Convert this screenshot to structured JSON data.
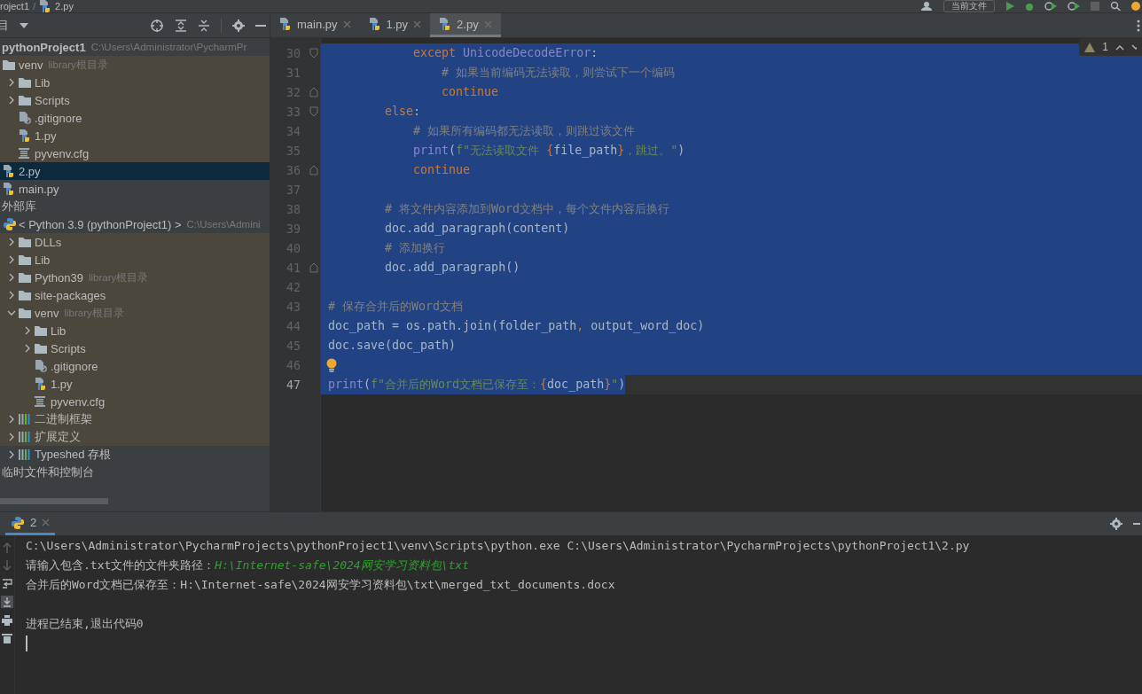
{
  "title_bar": {
    "breadcrumbs": [
      "roject1",
      "2.py"
    ],
    "separator": "/",
    "run_config": "当前文件"
  },
  "project_panel": {
    "title": "目",
    "tree": [
      {
        "kind": "project",
        "label": "pythonProject1",
        "hint": "C:\\Users\\Administrator\\PycharmPr",
        "library": false,
        "selected": false,
        "children": [
          {
            "kind": "folder",
            "label": "venv",
            "hint": "library根目录",
            "library": true,
            "selected": false,
            "children": [
              {
                "kind": "folder",
                "label": "Lib",
                "expanded": false,
                "library": true,
                "selected": false
              },
              {
                "kind": "folder",
                "label": "Scripts",
                "expanded": false,
                "library": true,
                "selected": false
              },
              {
                "kind": "ignore",
                "label": ".gitignore",
                "library": true,
                "selected": false
              },
              {
                "kind": "python",
                "label": "1.py",
                "library": true,
                "selected": false
              },
              {
                "kind": "config",
                "label": "pyvenv.cfg",
                "library": true,
                "selected": false
              }
            ]
          },
          {
            "kind": "python",
            "label": "2.py",
            "library": false,
            "selected": true
          },
          {
            "kind": "python",
            "label": "main.py",
            "library": false,
            "selected": false
          }
        ]
      },
      {
        "kind": "group",
        "label": "外部库",
        "library": false,
        "selected": false,
        "children": [
          {
            "kind": "sdk",
            "label": "< Python 3.9 (pythonProject1) >",
            "hint": "C:\\Users\\Admini",
            "library": false,
            "selected": false,
            "children": [
              {
                "kind": "folder",
                "label": "DLLs",
                "expanded": false,
                "library": true,
                "selected": false
              },
              {
                "kind": "folder",
                "label": "Lib",
                "expanded": false,
                "library": true,
                "selected": false
              },
              {
                "kind": "folder",
                "label": "Python39",
                "hint": "library根目录",
                "expanded": false,
                "library": true,
                "selected": false
              },
              {
                "kind": "folder",
                "label": "site-packages",
                "expanded": false,
                "library": true,
                "selected": false
              },
              {
                "kind": "folder",
                "label": "venv",
                "hint": "library根目录",
                "expanded": true,
                "library": true,
                "selected": false,
                "children": [
                  {
                    "kind": "folder",
                    "label": "Lib",
                    "expanded": false,
                    "library": true,
                    "selected": false
                  },
                  {
                    "kind": "folder",
                    "label": "Scripts",
                    "expanded": false,
                    "library": true,
                    "selected": false
                  },
                  {
                    "kind": "ignore",
                    "label": ".gitignore",
                    "library": true,
                    "selected": false
                  },
                  {
                    "kind": "python",
                    "label": "1.py",
                    "library": true,
                    "selected": false
                  },
                  {
                    "kind": "config",
                    "label": "pyvenv.cfg",
                    "library": true,
                    "selected": false
                  }
                ]
              },
              {
                "kind": "library",
                "label": "二进制框架",
                "expanded": false,
                "library": true,
                "selected": false
              },
              {
                "kind": "library",
                "label": "扩展定义",
                "expanded": false,
                "library": true,
                "selected": false
              },
              {
                "kind": "library",
                "label": "Typeshed 存根",
                "expanded": false,
                "library": false,
                "selected": false
              }
            ]
          }
        ]
      },
      {
        "kind": "group",
        "label": "临时文件和控制台",
        "library": false,
        "selected": false
      }
    ]
  },
  "editor": {
    "tabs": [
      {
        "label": "main.py",
        "selected": false
      },
      {
        "label": "1.py",
        "selected": false
      },
      {
        "label": "2.py",
        "selected": true
      }
    ],
    "warnings": "1",
    "lines": [
      {
        "number": "30",
        "selected": true,
        "current": false,
        "bulb": false,
        "fold_start": true,
        "fold_end": false,
        "segments": [
          {
            "kind": "keyword",
            "text": "            except "
          },
          {
            "kind": "builtin",
            "text": "UnicodeDecodeError"
          },
          {
            "kind": "plain",
            "text": ":"
          }
        ]
      },
      {
        "number": "31",
        "selected": true,
        "current": false,
        "bulb": false,
        "fold_start": false,
        "fold_end": false,
        "segments": [
          {
            "kind": "comment",
            "text": "                # 如果当前编码无法读取，则尝试下一个编码"
          }
        ]
      },
      {
        "number": "32",
        "selected": true,
        "current": false,
        "bulb": false,
        "fold_start": false,
        "fold_end": true,
        "segments": [
          {
            "kind": "keyword",
            "text": "                continue"
          }
        ]
      },
      {
        "number": "33",
        "selected": true,
        "current": false,
        "bulb": false,
        "fold_start": true,
        "fold_end": false,
        "segments": [
          {
            "kind": "keyword",
            "text": "        else"
          },
          {
            "kind": "plain",
            "text": ":"
          }
        ]
      },
      {
        "number": "34",
        "selected": true,
        "current": false,
        "bulb": false,
        "fold_start": false,
        "fold_end": false,
        "segments": [
          {
            "kind": "comment",
            "text": "            # 如果所有编码都无法读取，则跳过该文件"
          }
        ]
      },
      {
        "number": "35",
        "selected": true,
        "current": false,
        "bulb": false,
        "fold_start": false,
        "fold_end": false,
        "segments": [
          {
            "kind": "builtin",
            "text": "            print"
          },
          {
            "kind": "plain",
            "text": "("
          },
          {
            "kind": "string",
            "text": "f\"无法读取文件 "
          },
          {
            "kind": "operator",
            "text": "{"
          },
          {
            "kind": "plain",
            "text": "file_path"
          },
          {
            "kind": "operator",
            "text": "}"
          },
          {
            "kind": "string",
            "text": "，跳过。\""
          },
          {
            "kind": "plain",
            "text": ")"
          }
        ]
      },
      {
        "number": "36",
        "selected": true,
        "current": false,
        "bulb": false,
        "fold_start": false,
        "fold_end": true,
        "segments": [
          {
            "kind": "keyword",
            "text": "            continue"
          }
        ]
      },
      {
        "number": "37",
        "selected": true,
        "current": false,
        "bulb": false,
        "fold_start": false,
        "fold_end": false
      },
      {
        "number": "38",
        "selected": true,
        "current": false,
        "bulb": false,
        "fold_start": false,
        "fold_end": false,
        "segments": [
          {
            "kind": "comment",
            "text": "        # 将文件内容添加到Word文档中，每个文件内容后换行"
          }
        ]
      },
      {
        "number": "39",
        "selected": true,
        "current": false,
        "bulb": false,
        "fold_start": false,
        "fold_end": false,
        "segments": [
          {
            "kind": "plain",
            "text": "        doc.add_paragraph(content)"
          }
        ]
      },
      {
        "number": "40",
        "selected": true,
        "current": false,
        "bulb": false,
        "fold_start": false,
        "fold_end": false,
        "segments": [
          {
            "kind": "comment",
            "text": "        # 添加换行"
          }
        ]
      },
      {
        "number": "41",
        "selected": true,
        "current": false,
        "bulb": false,
        "fold_start": false,
        "fold_end": true,
        "segments": [
          {
            "kind": "plain",
            "text": "        doc.add_paragraph()"
          }
        ]
      },
      {
        "number": "42",
        "selected": true,
        "current": false,
        "bulb": false,
        "fold_start": false,
        "fold_end": false
      },
      {
        "number": "43",
        "selected": true,
        "current": false,
        "bulb": false,
        "fold_start": false,
        "fold_end": false,
        "segments": [
          {
            "kind": "comment",
            "text": "# 保存合并后的Word文档"
          }
        ]
      },
      {
        "number": "44",
        "selected": true,
        "current": false,
        "bulb": false,
        "fold_start": false,
        "fold_end": false,
        "segments": [
          {
            "kind": "plain",
            "text": "doc_path = os.path.join(folder_path"
          },
          {
            "kind": "operator",
            "text": ","
          },
          {
            "kind": "plain",
            "text": " output_word_doc)"
          }
        ]
      },
      {
        "number": "45",
        "selected": true,
        "current": false,
        "bulb": false,
        "fold_start": false,
        "fold_end": false,
        "segments": [
          {
            "kind": "plain",
            "text": "doc.save(doc_path)"
          }
        ]
      },
      {
        "number": "46",
        "selected": true,
        "current": false,
        "bulb": true,
        "fold_start": false,
        "fold_end": false
      },
      {
        "number": "47",
        "selected": true,
        "current": true,
        "bulb": false,
        "fold_start": false,
        "fold_end": false,
        "segments": [
          {
            "kind": "builtin",
            "text": "print"
          },
          {
            "kind": "plain",
            "text": "("
          },
          {
            "kind": "string",
            "text": "f\"合并后的Word文档已保存至："
          },
          {
            "kind": "operator",
            "text": "{"
          },
          {
            "kind": "plain",
            "text": "doc_path"
          },
          {
            "kind": "operator",
            "text": "}"
          },
          {
            "kind": "string",
            "text": "\""
          },
          {
            "kind": "plain",
            "text": ")"
          }
        ]
      }
    ]
  },
  "run_panel": {
    "tabs": [
      {
        "label": "2",
        "selected": true
      }
    ],
    "output": [
      {
        "segments": [
          {
            "kind": "plain",
            "text": "C:\\Users\\Administrator\\PycharmProjects\\pythonProject1\\venv\\Scripts\\python.exe C:\\Users\\Administrator\\PycharmProjects\\pythonProject1\\2.py"
          }
        ]
      },
      {
        "segments": [
          {
            "kind": "plain",
            "text": "请输入包含.txt文件的文件夹路径："
          },
          {
            "kind": "input",
            "text": "H:\\Internet-safe\\2024网安学习资料包\\txt"
          }
        ]
      },
      {
        "segments": [
          {
            "kind": "plain",
            "text": "合并后的Word文档已保存至：H:\\Internet-safe\\2024网安学习资料包\\txt\\merged_txt_documents.docx"
          }
        ]
      }
    ],
    "exit_message": "进程已结束,退出代码0"
  }
}
